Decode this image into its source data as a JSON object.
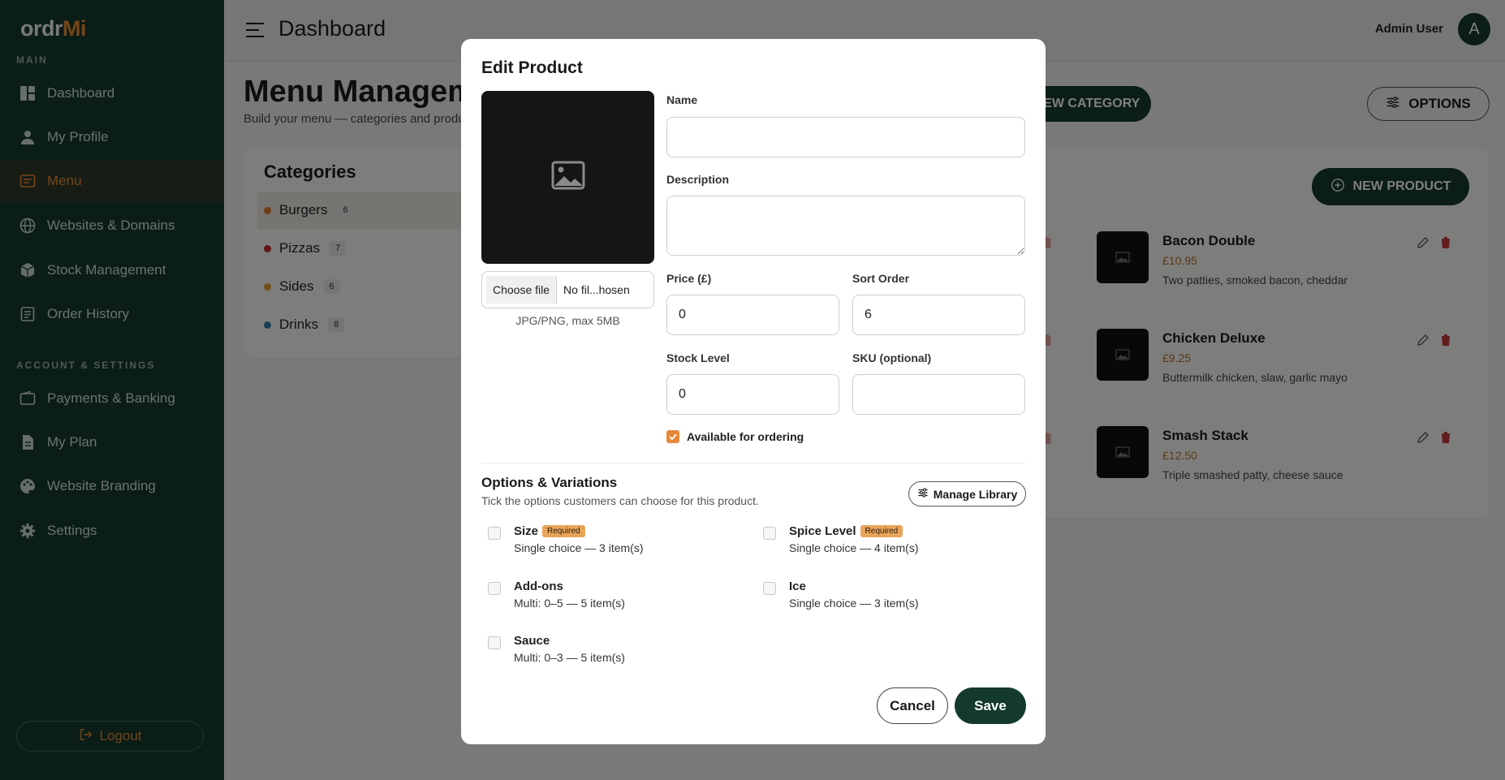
{
  "brand": {
    "name_part1": "ordr",
    "name_part2": "Mi"
  },
  "sidebar": {
    "main_label": "MAIN",
    "main_items": [
      {
        "label": "Dashboard",
        "icon": "dashboard-icon"
      },
      {
        "label": "My Profile",
        "icon": "user-icon"
      },
      {
        "label": "Menu",
        "icon": "menu-icon",
        "active": true
      },
      {
        "label": "Websites & Domains",
        "icon": "globe-icon"
      },
      {
        "label": "Stock Management",
        "icon": "box-icon"
      },
      {
        "label": "Order History",
        "icon": "receipt-icon"
      }
    ],
    "account_label": "ACCOUNT & SETTINGS",
    "account_items": [
      {
        "label": "Payments & Banking",
        "icon": "wallet-icon"
      },
      {
        "label": "My Plan",
        "icon": "document-icon"
      },
      {
        "label": "Website Branding",
        "icon": "palette-icon"
      },
      {
        "label": "Settings",
        "icon": "gear-icon"
      }
    ],
    "logout_label": "Logout"
  },
  "header": {
    "title": "Dashboard",
    "user_name": "Admin User",
    "avatar_initial": "A"
  },
  "page": {
    "title": "Menu Management",
    "subtitle": "Build your menu — categories and products",
    "new_category_label": "NEW CATEGORY",
    "options_label": "OPTIONS",
    "new_product_label": "NEW PRODUCT"
  },
  "categories": {
    "title": "Categories",
    "items": [
      {
        "name": "Burgers",
        "count": "6",
        "color": "#e07a2a"
      },
      {
        "name": "Pizzas",
        "count": "7",
        "color": "#c62828"
      },
      {
        "name": "Sides",
        "count": "6",
        "color": "#e0a030"
      },
      {
        "name": "Drinks",
        "count": "8",
        "color": "#2e7fa8"
      }
    ]
  },
  "products": [
    {
      "name": "Bacon Double",
      "price": "£10.95",
      "description": "Two patties, smoked bacon, cheddar"
    },
    {
      "name": "Chicken Deluxe",
      "price": "£9.25",
      "description": "Buttermilk chicken, slaw, garlic mayo"
    },
    {
      "name": "Smash Stack",
      "price": "£12.50",
      "description": "Triple smashed patty, cheese sauce"
    }
  ],
  "modal": {
    "title": "Edit Product",
    "file_button": "Choose file",
    "file_name": "No fil...hosen",
    "file_hint": "JPG/PNG, max 5MB",
    "name_label": "Name",
    "name_value": "",
    "description_label": "Description",
    "description_value": "",
    "price_label": "Price (£)",
    "price_value": "0",
    "sort_label": "Sort Order",
    "sort_value": "6",
    "stock_label": "Stock Level",
    "stock_value": "0",
    "sku_label": "SKU (optional)",
    "sku_value": "",
    "available_label": "Available for ordering",
    "available_checked": true,
    "options_title": "Options & Variations",
    "options_subtitle": "Tick the options customers can choose for this product.",
    "manage_library_label": "Manage Library",
    "options": [
      {
        "name": "Size",
        "required": true,
        "desc": "Single choice — 3 item(s)"
      },
      {
        "name": "Spice Level",
        "required": true,
        "desc": "Single choice — 4 item(s)"
      },
      {
        "name": "Add-ons",
        "required": false,
        "desc": "Multi: 0–5 — 5 item(s)"
      },
      {
        "name": "Ice",
        "required": false,
        "desc": "Single choice — 3 item(s)"
      },
      {
        "name": "Sauce",
        "required": false,
        "desc": "Multi: 0–3 — 5 item(s)"
      }
    ],
    "required_badge": "Required",
    "cancel_label": "Cancel",
    "save_label": "Save"
  },
  "colors": {
    "sidebar": "#143a2f",
    "accent": "#e98a35",
    "primary": "#143a2f"
  }
}
